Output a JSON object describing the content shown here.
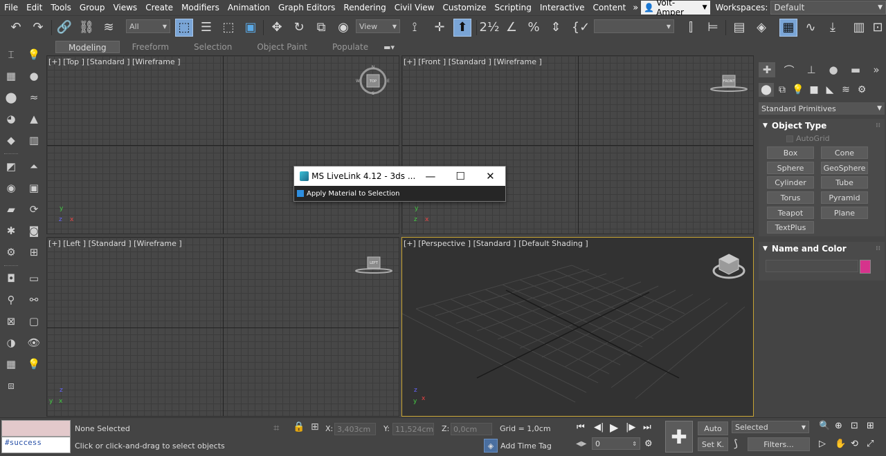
{
  "menubar": {
    "items": [
      "File",
      "Edit",
      "Tools",
      "Group",
      "Views",
      "Create",
      "Modifiers",
      "Animation",
      "Graph Editors",
      "Rendering",
      "Civil View",
      "Customize",
      "Scripting",
      "Interactive",
      "Content"
    ],
    "overflow": "»",
    "user": "Volt-Amper",
    "workspaces_label": "Workspaces:",
    "workspace_value": "Default"
  },
  "toolbar": {
    "selection_filter": "All",
    "reference_coord": "View",
    "named_selection": ""
  },
  "ribbon": {
    "tabs": [
      "Modeling",
      "Freeform",
      "Selection",
      "Object Paint",
      "Populate"
    ]
  },
  "viewports": {
    "top": {
      "label": "[+] [Top ] [Standard ] [Wireframe ]",
      "cube": "TOP"
    },
    "front": {
      "label": "[+] [Front ] [Standard ] [Wireframe ]",
      "cube": "FRONT"
    },
    "left": {
      "label": "[+] [Left ] [Standard ] [Wireframe ]",
      "cube": "LEFT"
    },
    "perspective": {
      "label": "[+] [Perspective ] [Standard ] [Default Shading ]"
    },
    "compass": {
      "n": "N",
      "s": "S",
      "e": "E",
      "w": "W"
    },
    "axis": {
      "x": "x",
      "y": "y",
      "z": "z"
    }
  },
  "dialog": {
    "title": "MS LiveLink 4.12 - 3ds ...",
    "checkbox_label": "Apply Material to Selection"
  },
  "command_panel": {
    "category": "Standard Primitives",
    "object_type_title": "Object Type",
    "autogrid": "AutoGrid",
    "buttons": [
      "Box",
      "Cone",
      "Sphere",
      "GeoSphere",
      "Cylinder",
      "Tube",
      "Torus",
      "Pyramid",
      "Teapot",
      "Plane",
      "TextPlus"
    ],
    "name_color_title": "Name and Color",
    "name_value": "",
    "object_color": "#d6338c"
  },
  "statusbar": {
    "maxscript_output": "#success",
    "selection_status": "None Selected",
    "prompt": "Click or click-and-drag to select objects",
    "x_label": "X:",
    "x_value": "3,403cm",
    "y_label": "Y:",
    "y_value": "11,524cm",
    "z_label": "Z:",
    "z_value": "0,0cm",
    "grid": "Grid = 1,0cm",
    "add_time_tag": "Add Time Tag",
    "frame": "0",
    "auto_key": "Auto",
    "set_key": "Set K.",
    "key_filter": "Selected",
    "filters": "Filters..."
  }
}
